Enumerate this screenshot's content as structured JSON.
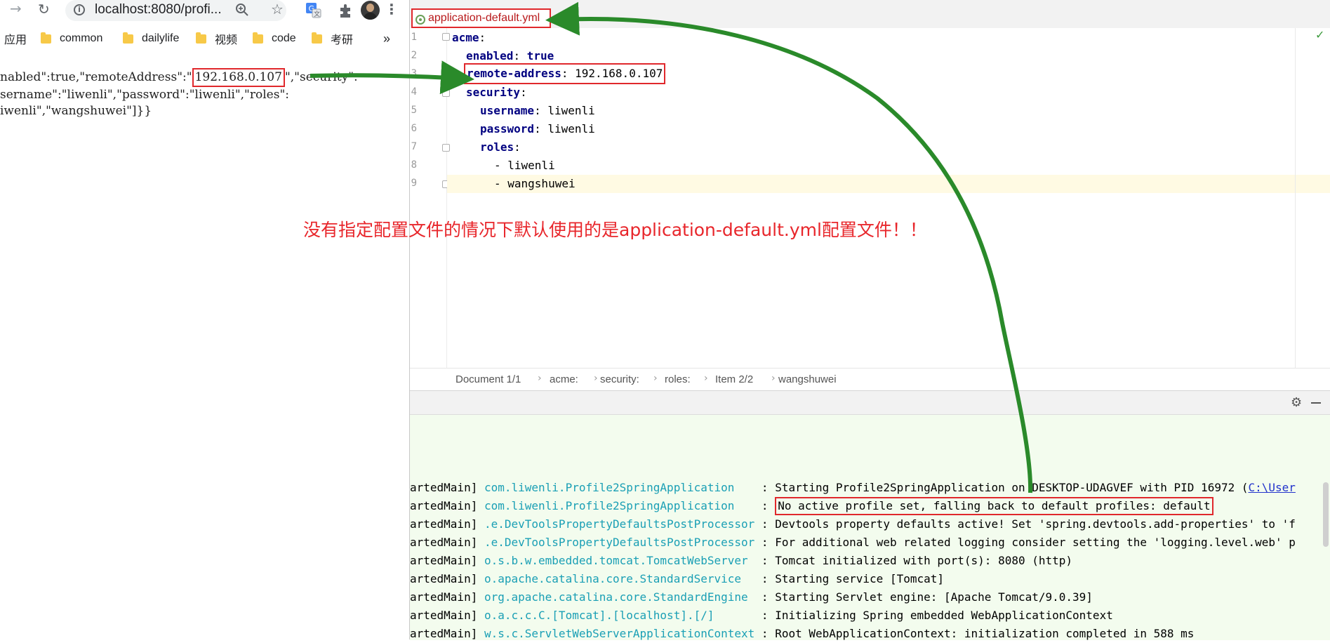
{
  "browser": {
    "url": "localhost:8080/profi...",
    "bookmarks": {
      "apps_label": "应用",
      "items": [
        "common",
        "dailylife",
        "视频",
        "code",
        "考研"
      ],
      "more": "»"
    },
    "json_lines": {
      "line1_prefix": "nabled\":true,\"remoteAddress\":\"",
      "address": "192.168.0.107",
      "line1_suffix": "\",\"security\":",
      "line2": "sername\":\"liwenli\",\"password\":\"liwenli\",\"roles\":",
      "line3": "iwenli\",\"wangshuwei\"]}}"
    }
  },
  "ide": {
    "tab_label": "application-default.yml",
    "editor": {
      "line_numbers": [
        "1",
        "2",
        "3",
        "4",
        "5",
        "6",
        "7",
        "8",
        "9"
      ],
      "lines": [
        {
          "key": "acme",
          "value": ""
        },
        {
          "key": "enabled",
          "value": "true"
        },
        {
          "key": "remote-address",
          "value": "192.168.0.107"
        },
        {
          "key": "security",
          "value": ""
        },
        {
          "key": "username",
          "value": "liwenli"
        },
        {
          "key": "password",
          "value": "liwenli"
        },
        {
          "key": "roles",
          "value": ""
        },
        {
          "item": "- liwenli"
        },
        {
          "item": "- wangshuwei"
        }
      ]
    },
    "breadcrumb": [
      "Document 1/1",
      "acme:",
      "security:",
      "roles:",
      "Item 2/2",
      "wangshuwei"
    ],
    "console": {
      "rows": [
        {
          "thread": "artedMain]",
          "logger": "com.liwenli.Profile2SpringApplication",
          "message": "Starting Profile2SpringApplication on DESKTOP-UDAGVEF with PID 16972 (",
          "link": "C:\\User"
        },
        {
          "thread": "artedMain]",
          "logger": "com.liwenli.Profile2SpringApplication",
          "message": "No active profile set, falling back to default profiles: default"
        },
        {
          "thread": "artedMain]",
          "logger": ".e.DevToolsPropertyDefaultsPostProcessor",
          "message": "Devtools property defaults active! Set 'spring.devtools.add-properties' to 'f"
        },
        {
          "thread": "artedMain]",
          "logger": ".e.DevToolsPropertyDefaultsPostProcessor",
          "message": "For additional web related logging consider setting the 'logging.level.web' p"
        },
        {
          "thread": "artedMain]",
          "logger": "o.s.b.w.embedded.tomcat.TomcatWebServer",
          "message": "Tomcat initialized with port(s): 8080 (http)"
        },
        {
          "thread": "artedMain]",
          "logger": "o.apache.catalina.core.StandardService",
          "message": "Starting service [Tomcat]"
        },
        {
          "thread": "artedMain]",
          "logger": "org.apache.catalina.core.StandardEngine",
          "message": "Starting Servlet engine: [Apache Tomcat/9.0.39]"
        },
        {
          "thread": "artedMain]",
          "logger": "o.a.c.c.C.[Tomcat].[localhost].[/]",
          "message": "Initializing Spring embedded WebApplicationContext"
        },
        {
          "thread": "artedMain]",
          "logger": "w.s.c.ServletWebServerApplicationContext",
          "message": "Root WebApplicationContext: initialization completed in 588 ms"
        }
      ]
    }
  },
  "annotation": "没有指定配置文件的情况下默认使用的是application-default.yml配置文件！！",
  "colors": {
    "highlight_box": "#e0282c",
    "arrow": "#2a8a2a",
    "console_bg": "#f3fcee",
    "logger_text": "#1a9fb5"
  },
  "icons": [
    "back-arrow-icon",
    "reload-icon",
    "info-icon",
    "zoom-icon",
    "star-icon",
    "translate-icon",
    "extensions-icon",
    "profile-avatar-icon",
    "menu-kebab-icon",
    "gear-icon",
    "minimize-icon",
    "checkmark-icon",
    "yaml-file-icon"
  ]
}
